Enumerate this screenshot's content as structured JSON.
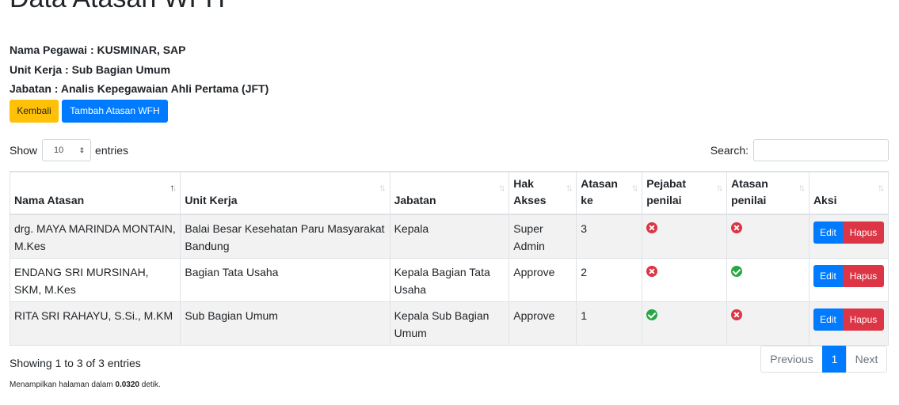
{
  "page_title": "Data Atasan WFH",
  "employee": {
    "nama": "Nama Pegawai : KUSMINAR, SAP",
    "unit": "Unit Kerja : Sub Bagian Umum",
    "jabatan": "Jabatan : Analis Kepegawaian Ahli Pertama (JFT)"
  },
  "actions": {
    "back_label": "Kembali",
    "add_label": "Tambah Atasan WFH"
  },
  "table_controls": {
    "show_label": "Show",
    "length_value": "10",
    "entries_label": "entries",
    "search_label": "Search:",
    "search_value": ""
  },
  "table": {
    "headers": [
      "Nama Atasan",
      "Unit Kerja",
      "Jabatan",
      "Hak Akses",
      "Atasan ke",
      "Pejabat penilai",
      "Atasan penilai",
      "Aksi"
    ],
    "rows": [
      {
        "nama": "drg. MAYA MARINDA MONTAIN, M.Kes",
        "unit": "Balai Besar Kesehatan Paru Masyarakat Bandung",
        "jabatan": "Kepala",
        "hak": "Super Admin",
        "ke": "3",
        "pejabat_penilai": "no",
        "atasan_penilai": "no",
        "edit": "Edit",
        "hapus": "Hapus"
      },
      {
        "nama": "ENDANG SRI MURSINAH, SKM, M.Kes",
        "unit": "Bagian Tata Usaha",
        "jabatan": "Kepala Bagian Tata Usaha",
        "hak": "Approve",
        "ke": "2",
        "pejabat_penilai": "no",
        "atasan_penilai": "yes",
        "edit": "Edit",
        "hapus": "Hapus"
      },
      {
        "nama": "RITA SRI RAHAYU, S.Si., M.KM",
        "unit": "Sub Bagian Umum",
        "jabatan": "Kepala Sub Bagian Umum",
        "hak": "Approve",
        "ke": "1",
        "pejabat_penilai": "yes",
        "atasan_penilai": "no",
        "edit": "Edit",
        "hapus": "Hapus"
      }
    ]
  },
  "footer": {
    "info": "Showing 1 to 3 of 3 entries",
    "runtime_prefix": "Menampilkan halaman dalam ",
    "runtime_value": "0.0320",
    "runtime_suffix": " detik."
  },
  "pagination": {
    "previous": "Previous",
    "current": "1",
    "next": "Next"
  },
  "colors": {
    "primary": "#007bff",
    "warning": "#ffc107",
    "danger": "#dc3545",
    "success": "#28a745"
  },
  "icons": {
    "yes": "check-circle-icon",
    "no": "times-circle-icon"
  }
}
